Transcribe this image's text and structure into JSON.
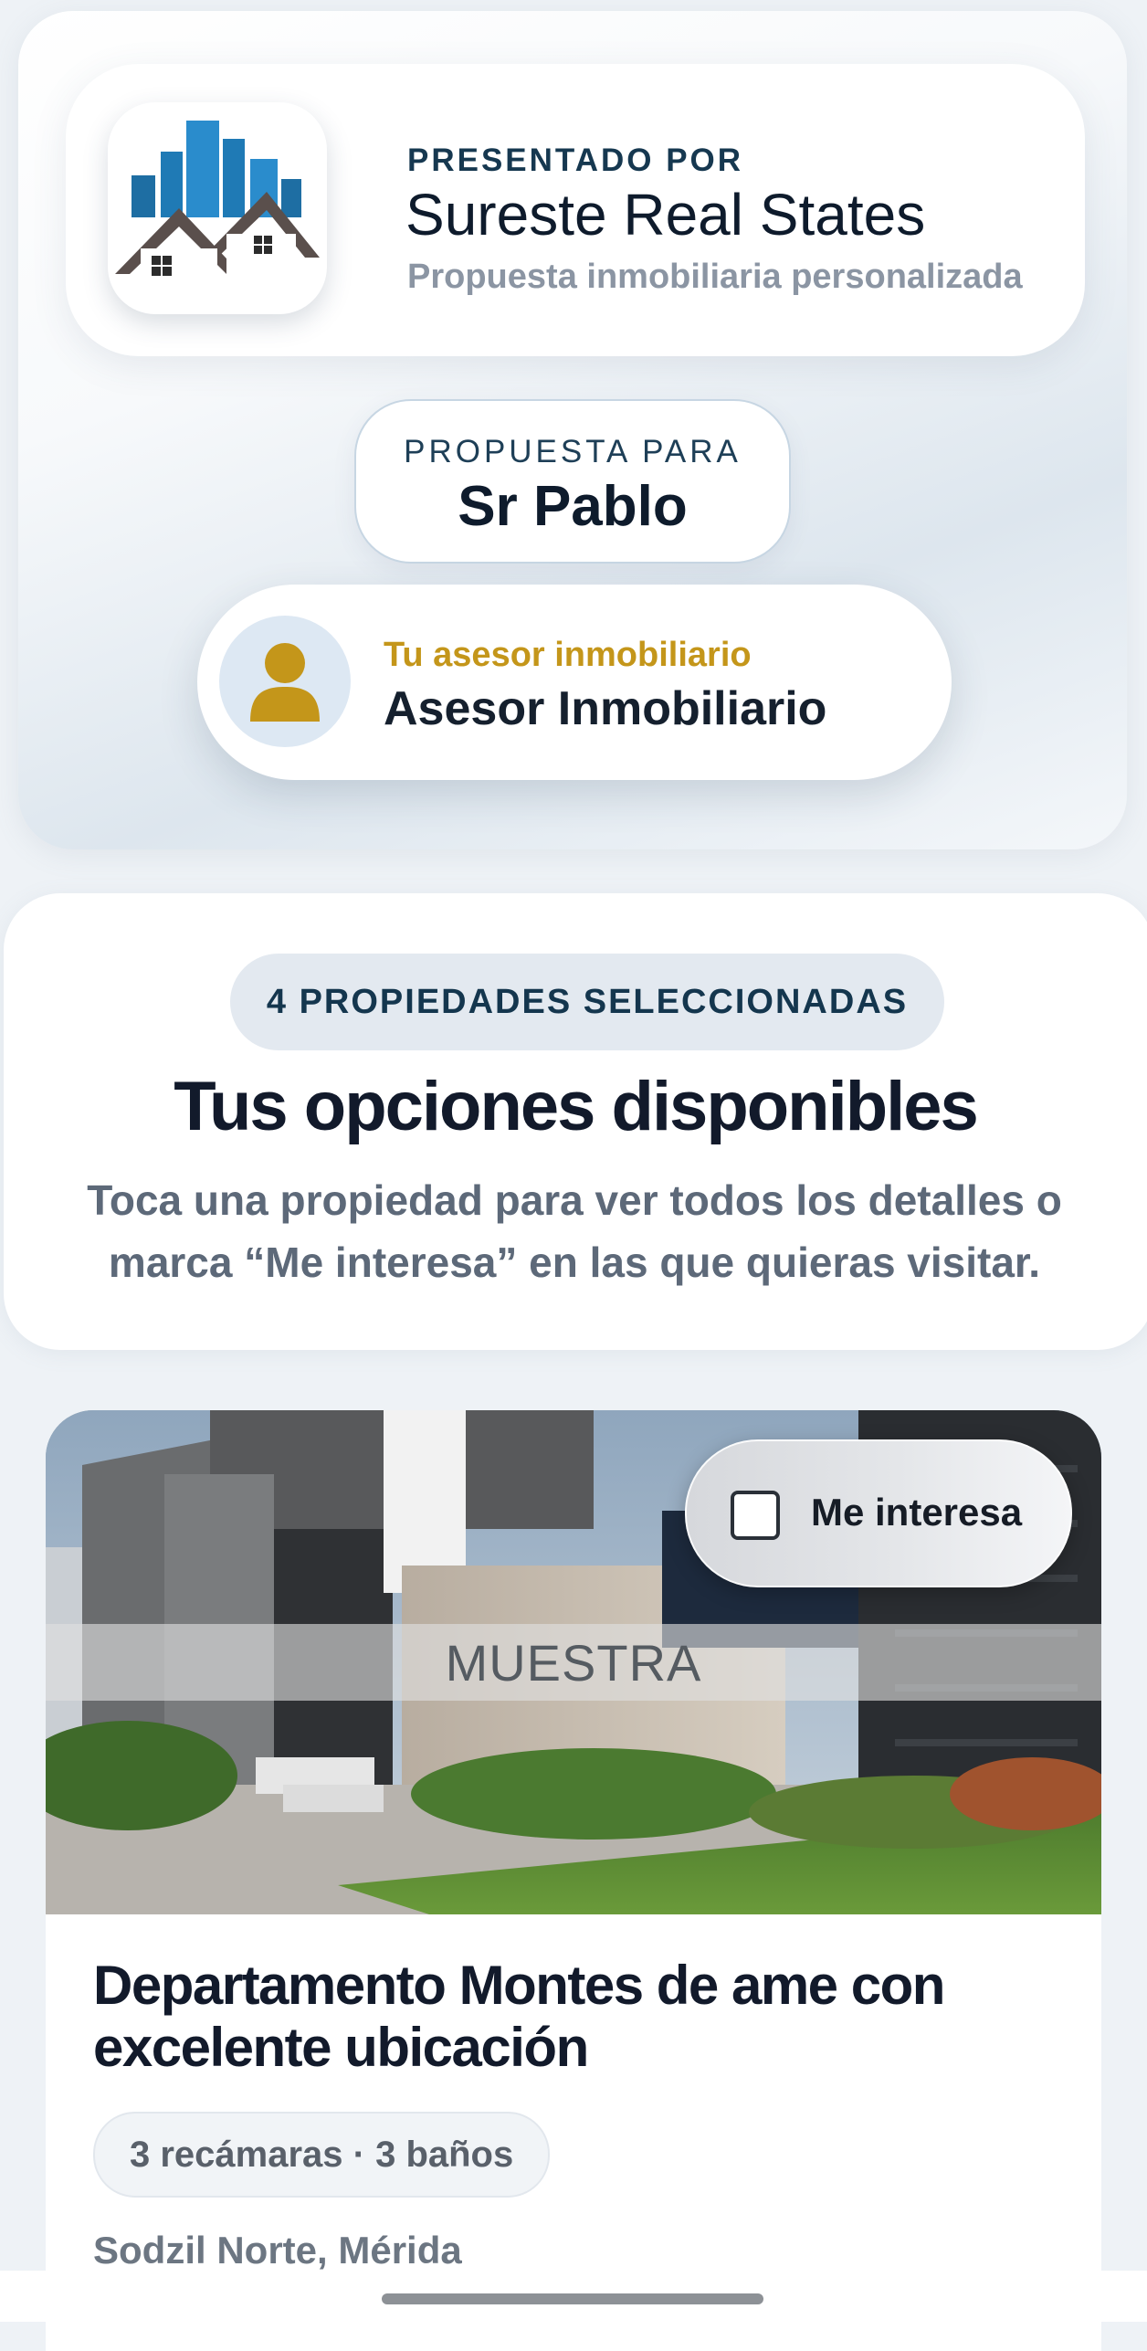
{
  "brand": {
    "kicker": "PRESENTADO POR",
    "name": "Sureste Real States",
    "subtitle": "Propuesta inmobiliaria personalizada",
    "logo_icon": "buildings-houses-logo"
  },
  "proposal": {
    "kicker": "PROPUESTA PARA",
    "client_name": "Sr Pablo"
  },
  "advisor": {
    "role": "Tu asesor inmobiliario",
    "name": "Asesor Inmobiliario",
    "avatar_icon": "person-icon",
    "accent_color": "#c4961a"
  },
  "options": {
    "count_badge": "4 PROPIEDADES SELECCIONADAS",
    "title": "Tus opciones disponibles",
    "subtitle": "Toca una propiedad para ver todos los detalles o marca “Me interesa” en las que quieras visitar."
  },
  "properties": [
    {
      "title": "Departamento Montes de ame con excelente ubicación",
      "specs": "3 recámaras · 3 baños",
      "location": "Sodzil Norte, Mérida",
      "watermark": "MUESTRA",
      "interest_label": "Me interesa",
      "interest_checked": false
    }
  ]
}
